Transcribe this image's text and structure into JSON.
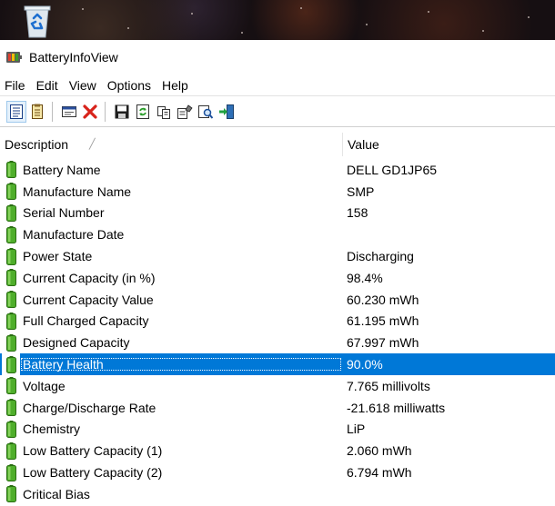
{
  "window": {
    "title": "BatteryInfoView",
    "app_icon": "battery-app-icon"
  },
  "desktop": {
    "icon": "recycle-bin-icon"
  },
  "menu": [
    "File",
    "Edit",
    "View",
    "Options",
    "Help"
  ],
  "toolbar": {
    "buttons": [
      "battery-info-mode-icon",
      "battery-log-mode-icon",
      "properties-window-icon",
      "delete-icon",
      "save-icon",
      "refresh-icon",
      "copy-icon",
      "html-report-icon",
      "find-icon",
      "exit-icon"
    ]
  },
  "columns": {
    "description": "Description",
    "value": "Value"
  },
  "rows": [
    {
      "description": "Battery Name",
      "value": "DELL GD1JP65"
    },
    {
      "description": "Manufacture Name",
      "value": "SMP"
    },
    {
      "description": "Serial Number",
      "value": "158"
    },
    {
      "description": "Manufacture Date",
      "value": ""
    },
    {
      "description": "Power State",
      "value": "Discharging"
    },
    {
      "description": "Current Capacity (in %)",
      "value": "98.4%"
    },
    {
      "description": "Current Capacity Value",
      "value": "60.230 mWh"
    },
    {
      "description": "Full Charged Capacity",
      "value": "61.195 mWh"
    },
    {
      "description": "Designed Capacity",
      "value": "67.997 mWh"
    },
    {
      "description": "Battery Health",
      "value": "90.0%"
    },
    {
      "description": "Voltage",
      "value": "7.765 millivolts"
    },
    {
      "description": "Charge/Discharge Rate",
      "value": "-21.618 milliwatts"
    },
    {
      "description": "Chemistry",
      "value": "LiP"
    },
    {
      "description": "Low Battery Capacity (1)",
      "value": "2.060 mWh"
    },
    {
      "description": "Low Battery Capacity (2)",
      "value": "6.794 mWh"
    },
    {
      "description": "Critical Bias",
      "value": ""
    }
  ],
  "selected_row": "Battery Health",
  "colors": {
    "selection": "#0078d7",
    "battery_icon": "#3c8f1e"
  }
}
